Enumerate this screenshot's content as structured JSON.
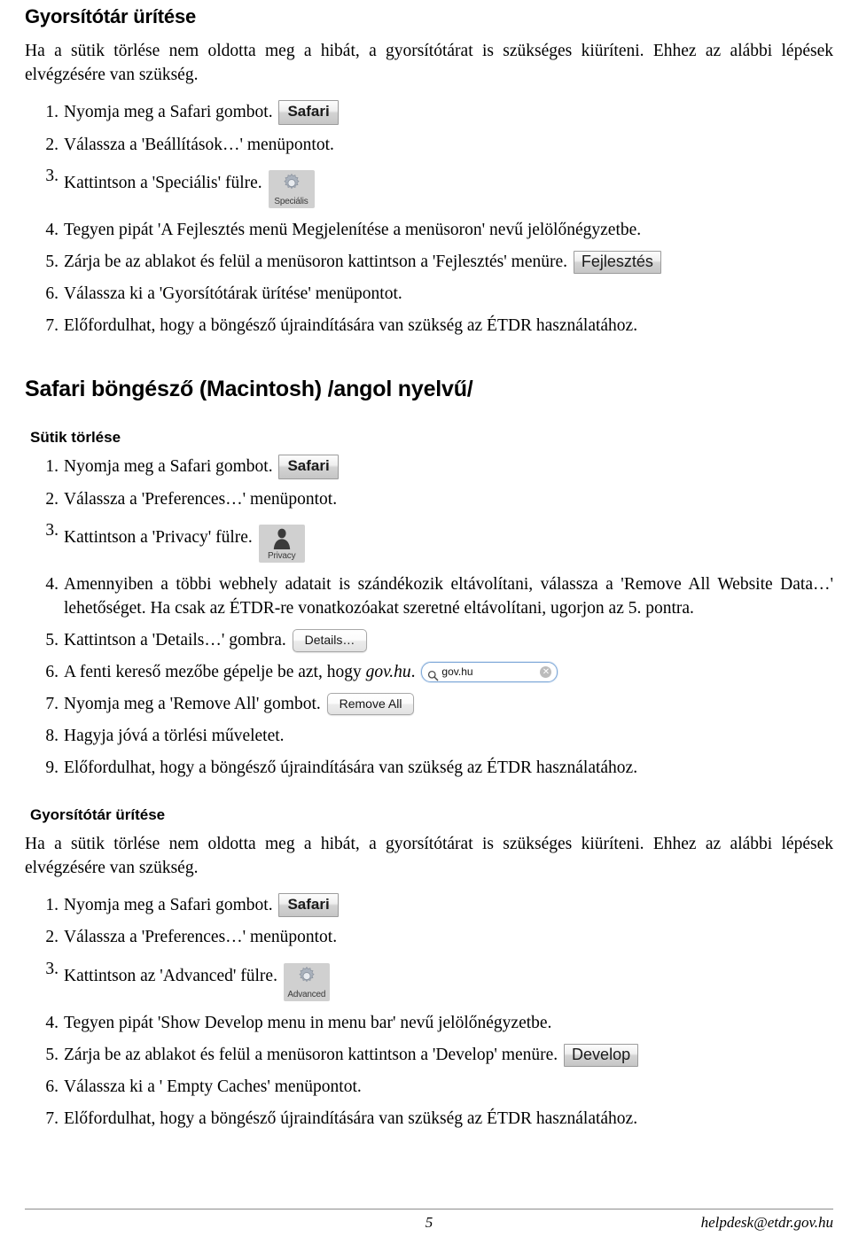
{
  "page": {
    "number": "5",
    "contact": "helpdesk@etdr.gov.hu"
  },
  "block1": {
    "heading": "Gyorsítótár ürítése",
    "intro": "Ha a sütik törlése nem oldotta meg a hibát, a gyorsítótárat is szükséges kiüríteni. Ehhez az alábbi lépések elvégzésére van szükség.",
    "steps": [
      {
        "text": "Nyomja meg a Safari gombot.",
        "chip": "safari"
      },
      {
        "text": "Válassza a 'Beállítások…' menüpontot.",
        "chip": null
      },
      {
        "text": "Kattintson a 'Speciális' fülre.",
        "chip": "specialis"
      },
      {
        "text": "Tegyen pipát 'A Fejlesztés menü Megjelenítése a menüsoron' nevű jelölőnégyzetbe.",
        "chip": null
      },
      {
        "text": "Zárja be az ablakot és felül a menüsoron kattintson a 'Fejlesztés' menüre.",
        "chip": "fejlesztes"
      },
      {
        "text": "Válassza ki a 'Gyorsítótárak ürítése' menüpontot.",
        "chip": null
      },
      {
        "text": "Előfordulhat, hogy a böngésző újraindítására van szükség az ÉTDR használatához.",
        "chip": null
      }
    ]
  },
  "section": {
    "heading": "Safari böngésző (Macintosh) /angol nyelvű/"
  },
  "block2": {
    "heading": "Sütik törlése",
    "steps": [
      {
        "text": "Nyomja meg a Safari gombot.",
        "chip": "safari"
      },
      {
        "text": "Válassza a 'Preferences…' menüpontot.",
        "chip": null
      },
      {
        "text": "Kattintson a 'Privacy' fülre.",
        "chip": "privacy"
      },
      {
        "text": "Amennyiben a többi webhely adatait is szándékozik eltávolítani, válassza a 'Remove All Website Data…' lehetőséget. Ha csak az ÉTDR-re vonatkozóakat szeretné eltávolítani, ugorjon az 5. pontra.",
        "chip": null
      },
      {
        "text": "Kattintson a 'Details…' gombra.",
        "chip": "details"
      },
      {
        "text": "A fenti kereső mezőbe gépelje be azt, hogy ",
        "text_italic": "gov.hu",
        "text_after": ".",
        "chip": "search"
      },
      {
        "text": "Nyomja meg a 'Remove All' gombot.",
        "chip": "removeall"
      },
      {
        "text": "Hagyja jóvá a törlési műveletet.",
        "chip": null
      },
      {
        "text": "Előfordulhat, hogy a böngésző újraindítására van szükség az ÉTDR használatához.",
        "chip": null
      }
    ]
  },
  "block3": {
    "heading": "Gyorsítótár ürítése",
    "intro": "Ha a sütik törlése nem oldotta meg a hibát, a gyorsítótárat is szükséges kiüríteni. Ehhez az alábbi lépések elvégzésére van szükség.",
    "steps": [
      {
        "text": "Nyomja meg a Safari gombot.",
        "chip": "safari"
      },
      {
        "text": "Válassza a 'Preferences…' menüpontot.",
        "chip": null
      },
      {
        "text": "Kattintson az 'Advanced' fülre.",
        "chip": "advanced"
      },
      {
        "text": "Tegyen pipát 'Show Develop menu in menu bar' nevű jelölőnégyzetbe.",
        "chip": null
      },
      {
        "text": "Zárja be az ablakot és felül a menüsoron kattintson a 'Develop' menüre.",
        "chip": "develop"
      },
      {
        "text": "Válassza ki a ' Empty Caches' menüpontot.",
        "chip": null
      },
      {
        "text": "Előfordulhat, hogy a böngésző újraindítására van szükség az ÉTDR használatához.",
        "chip": null
      }
    ]
  },
  "chips": {
    "safari_label": "Safari",
    "fejlesztes_label": "Fejlesztés",
    "develop_label": "Develop",
    "specialis_label": "Speciális",
    "privacy_label": "Privacy",
    "advanced_label": "Advanced",
    "details_label": "Details…",
    "removeall_label": "Remove All",
    "search_value": "gov.hu",
    "search_clear": "✕"
  }
}
